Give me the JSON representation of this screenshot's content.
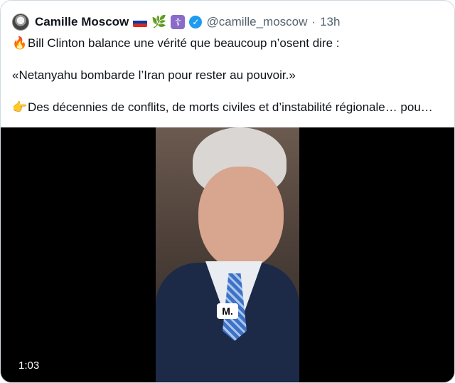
{
  "tweet": {
    "author_name": "Camille Moscow",
    "handle": "@camille_moscow",
    "separator": "·",
    "time": "13h",
    "line1_emoji": "🔥",
    "line1": "Bill Clinton balance une vérité que beaucoup n’osent dire :",
    "line2": "«Netanyahu bombarde l’Iran pour rester au pouvoir.»",
    "line3_emoji": "👉",
    "line3": "Des décennies de conflits, de morts civiles et d’instabilité régionale… pou…"
  },
  "media": {
    "watermark": "M.",
    "duration": "1:03"
  },
  "icons": {
    "flag": "russia-flag",
    "leaf": "olive-branch",
    "cross": "orthodox-cross",
    "badge": "verified-badge"
  },
  "colors": {
    "verified": "#1d9bf0",
    "secondary_text": "#536471",
    "border": "#cfd9de"
  }
}
